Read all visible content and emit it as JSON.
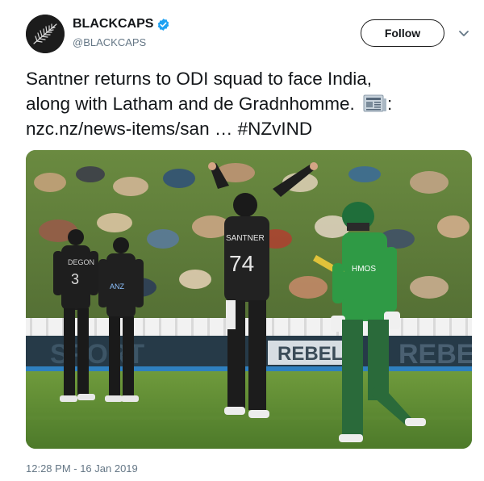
{
  "account": {
    "display_name": "BLACKCAPS",
    "handle": "@BLACKCAPS",
    "verified": true,
    "avatar_icon": "silver-fern-logo-icon"
  },
  "actions": {
    "follow_label": "Follow",
    "more_icon": "chevron-down-icon"
  },
  "tweet": {
    "line1": "Santner returns to ODI squad to face India,",
    "line2": "along with Latham and de Gradnhomme.",
    "line2_suffix": ":",
    "link_text": "nzc.nz/news-items/san",
    "ellipsis": " … ",
    "hashtag": "#NZvIND",
    "emoji_icon": "newspaper-icon"
  },
  "media": {
    "jersey_name": "SANTNER",
    "jersey_number": "74",
    "board_left": "SPORT",
    "board_mid": "REBEL",
    "board_right": "REBE",
    "sponsor_text": "HMOS",
    "player_left_number": "3",
    "player_left_name": "DEGON",
    "mid_player_logo": "ANZ"
  },
  "meta": {
    "timestamp": "12:28 PM - 16 Jan 2019"
  },
  "colors": {
    "text": "#14171a",
    "secondary": "#657786",
    "verified": "#1da1f2",
    "link": "#1da1f2"
  }
}
